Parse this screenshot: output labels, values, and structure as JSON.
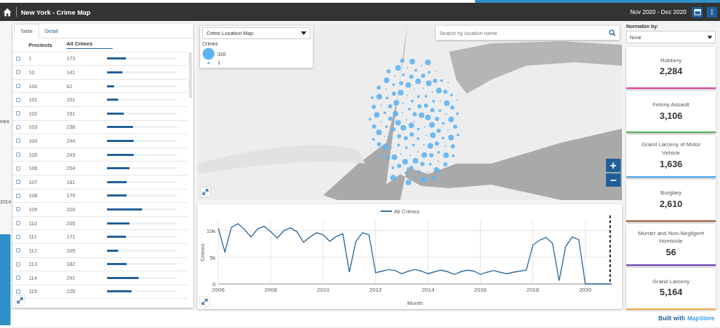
{
  "background_fragments": {
    "axis_title": "mes",
    "year_label": "2014"
  },
  "header": {
    "title": "New York - Crime Map",
    "date_range": "Nov 2020 - Dec 2020"
  },
  "table_panel": {
    "tabs": [
      {
        "label": "Table",
        "selected": true
      },
      {
        "label": "Detail",
        "selected": false
      }
    ],
    "columns": [
      {
        "label": "Precincts",
        "selected": false
      },
      {
        "label": "All Crimes",
        "selected": true
      }
    ],
    "rows": [
      {
        "precinct": "1",
        "crimes": "173",
        "level": 0.27,
        "checked": false
      },
      {
        "precinct": "10",
        "crimes": "141",
        "level": 0.22,
        "checked": false
      },
      {
        "precinct": "100",
        "crimes": "62",
        "level": 0.1,
        "checked": false
      },
      {
        "precinct": "101",
        "crimes": "101",
        "level": 0.16,
        "checked": false
      },
      {
        "precinct": "102",
        "crimes": "151",
        "level": 0.24,
        "checked": false
      },
      {
        "precinct": "103",
        "crimes": "238",
        "level": 0.37,
        "checked": false
      },
      {
        "precinct": "104",
        "crimes": "244",
        "level": 0.38,
        "checked": false
      },
      {
        "precinct": "105",
        "crimes": "243",
        "level": 0.38,
        "checked": false
      },
      {
        "precinct": "106",
        "crimes": "204",
        "level": 0.32,
        "checked": false
      },
      {
        "precinct": "107",
        "crimes": "181",
        "level": 0.28,
        "checked": false
      },
      {
        "precinct": "108",
        "crimes": "179",
        "level": 0.28,
        "checked": false
      },
      {
        "precinct": "109",
        "crimes": "318",
        "level": 0.5,
        "checked": false
      },
      {
        "precinct": "110",
        "crimes": "205",
        "level": 0.32,
        "checked": false
      },
      {
        "precinct": "111",
        "crimes": "171",
        "level": 0.27,
        "checked": false
      },
      {
        "precinct": "112",
        "crimes": "105",
        "level": 0.16,
        "checked": false
      },
      {
        "precinct": "113",
        "crimes": "182",
        "level": 0.28,
        "checked": false
      },
      {
        "precinct": "114",
        "crimes": "291",
        "level": 0.45,
        "checked": false
      },
      {
        "precinct": "115",
        "crimes": "225",
        "level": 0.35,
        "checked": false
      }
    ]
  },
  "map": {
    "layer_select": "Crime Location Map",
    "legend": {
      "title": "Crimes",
      "max_label": "310",
      "min_label": "1"
    },
    "search": {
      "placeholder": "Search by location name"
    },
    "zoom_in": "+",
    "zoom_out": "−"
  },
  "chart": {
    "chart_data": {
      "type": "line",
      "grid": true,
      "xlabel": "Month",
      "ylabel": "Crimes",
      "x": [
        2006,
        2006.25,
        2006.5,
        2006.75,
        2007,
        2007.25,
        2007.5,
        2007.75,
        2008,
        2008.25,
        2008.5,
        2008.75,
        2009,
        2009.25,
        2009.5,
        2009.75,
        2010,
        2010.25,
        2010.5,
        2010.75,
        2011,
        2011.25,
        2011.5,
        2011.75,
        2012,
        2012.25,
        2012.5,
        2012.75,
        2013,
        2013.25,
        2013.5,
        2013.75,
        2014,
        2014.25,
        2014.5,
        2014.75,
        2015,
        2015.25,
        2015.5,
        2015.75,
        2016,
        2016.25,
        2016.5,
        2016.75,
        2017,
        2017.25,
        2017.5,
        2017.75,
        2018,
        2018.25,
        2018.5,
        2018.75,
        2019,
        2019.25,
        2019.5,
        2019.75,
        2020,
        2020.25,
        2020.5,
        2020.75,
        2021
      ],
      "series": [
        {
          "name": "All Crimes",
          "color": "#2e6a9e",
          "values": [
            10400,
            6000,
            10600,
            11300,
            10200,
            8800,
            10300,
            10800,
            9800,
            8600,
            10000,
            10500,
            9800,
            7800,
            8800,
            9600,
            9200,
            8000,
            8900,
            9400,
            2200,
            8000,
            9600,
            9200,
            2100,
            2400,
            2700,
            2500,
            1900,
            2400,
            2700,
            2400,
            1900,
            2300,
            2600,
            2300,
            1800,
            2300,
            2600,
            2400,
            1800,
            2200,
            2500,
            2200,
            1900,
            2200,
            2400,
            2600,
            7300,
            8200,
            8700,
            7600,
            600,
            7000,
            8800,
            8300,
            0,
            0,
            0,
            0,
            0
          ]
        }
      ],
      "xlim": [
        2006,
        2021
      ],
      "ylim": [
        0,
        11800
      ],
      "xticks": [
        2006,
        2008,
        2010,
        2012,
        2014,
        2016,
        2018,
        2020
      ],
      "yticks": [
        {
          "value": 0,
          "label": "0"
        },
        {
          "value": 5000,
          "label": "5k"
        },
        {
          "value": 10000,
          "label": "10k"
        }
      ]
    }
  },
  "side_panel": {
    "normalize_label": "Normalize by:",
    "normalize_value": "None",
    "cards": [
      {
        "label": "Robbery",
        "value": "2,284",
        "color": "#e8399b"
      },
      {
        "label": "Felony Assault",
        "value": "3,106",
        "color": "#4caf50"
      },
      {
        "label": "Grand Larceny of Motor Vehicle",
        "value": "1,636",
        "color": "#42a5f5"
      },
      {
        "label": "Burglary",
        "value": "2,610",
        "color": "#9c5b3c"
      },
      {
        "label": "Murder and Non-Negligent Homicide",
        "value": "56",
        "color": "#6a3fb5"
      },
      {
        "label": "Grand Larceny",
        "value": "5,164",
        "color": "#f5a742"
      }
    ]
  },
  "footer": {
    "prefix": "Built with",
    "brand": "MapStore"
  }
}
